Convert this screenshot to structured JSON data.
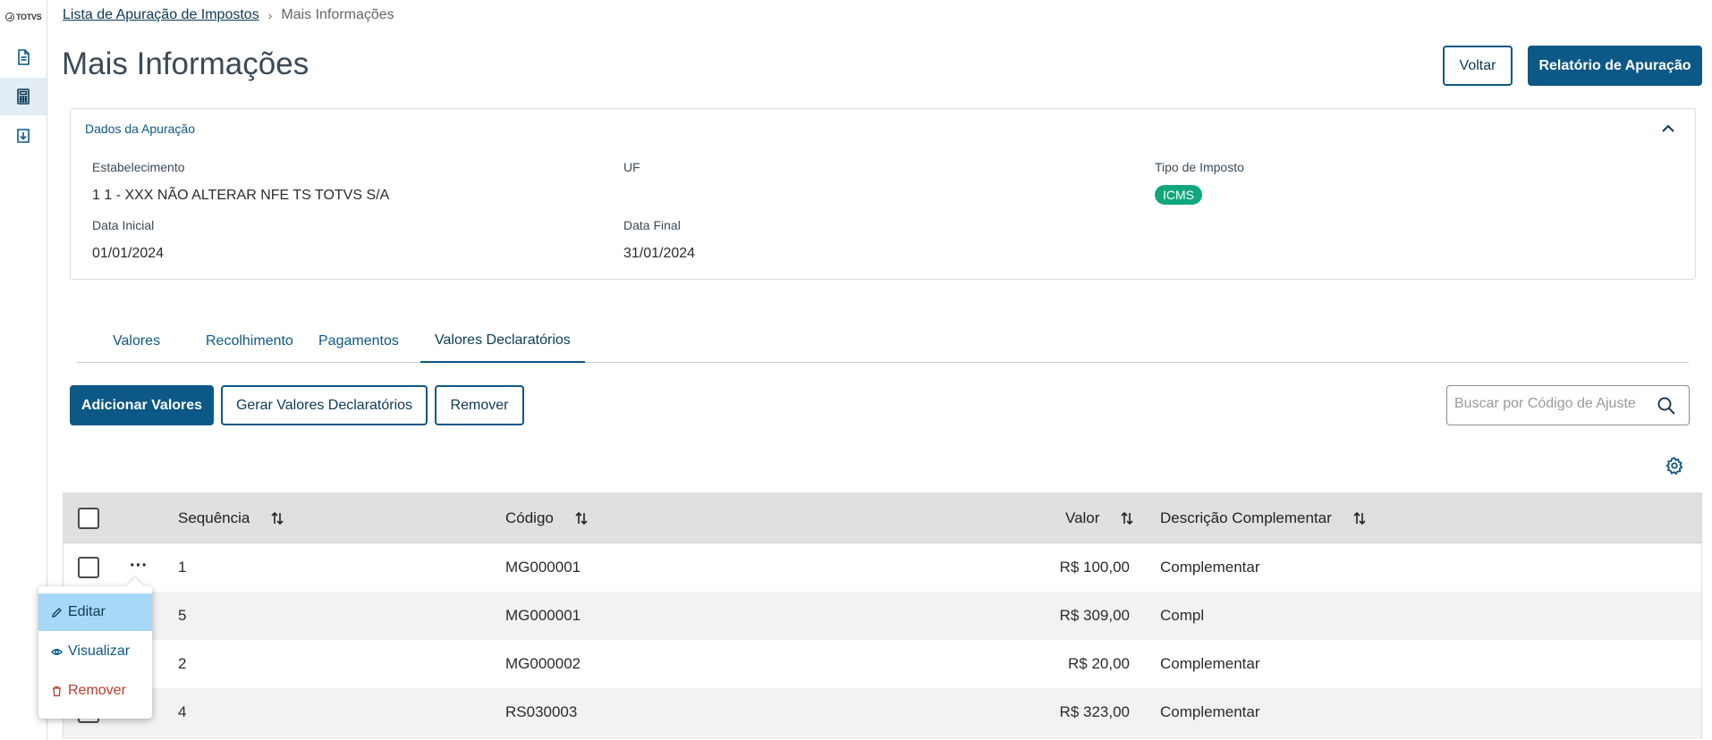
{
  "sidebar": {
    "logo_text": "TOTVS",
    "items": [
      {
        "icon": "document-icon",
        "active": false
      },
      {
        "icon": "calculator-icon",
        "active": true
      },
      {
        "icon": "download-document-icon",
        "active": false
      }
    ]
  },
  "breadcrumb": {
    "parent": "Lista de Apuração de Impostos",
    "current": "Mais Informações"
  },
  "page": {
    "title": "Mais Informações"
  },
  "header_actions": {
    "back_label": "Voltar",
    "report_label": "Relatório de Apuração"
  },
  "card": {
    "title": "Dados da Apuração",
    "fields": {
      "estabelecimento_label": "Estabelecimento",
      "estabelecimento_value": "1 1 - XXX NÃO ALTERAR NFE TS TOTVS S/A",
      "uf_label": "UF",
      "uf_value": "",
      "tipo_label": "Tipo de Imposto",
      "tipo_value": "ICMS",
      "data_inicial_label": "Data Inicial",
      "data_inicial_value": "01/01/2024",
      "data_final_label": "Data Final",
      "data_final_value": "31/01/2024"
    }
  },
  "tabs": [
    {
      "label": "Valores",
      "active": false
    },
    {
      "label": "Recolhimento",
      "active": false
    },
    {
      "label": "Pagamentos",
      "active": false
    },
    {
      "label": "Valores Declaratórios",
      "active": true
    }
  ],
  "toolbar": {
    "add_label": "Adicionar Valores",
    "generate_label": "Gerar Valores Declaratórios",
    "remove_label": "Remover",
    "search_placeholder": "Buscar por Código de Ajuste"
  },
  "table": {
    "columns": [
      "Sequência",
      "Código",
      "Valor",
      "Descrição Complementar"
    ],
    "rows": [
      {
        "sequencia": "1",
        "codigo": "MG000001",
        "valor": "R$ 100,00",
        "descricao": "Complementar"
      },
      {
        "sequencia": "5",
        "codigo": "MG000001",
        "valor": "R$ 309,00",
        "descricao": "Compl"
      },
      {
        "sequencia": "2",
        "codigo": "MG000002",
        "valor": "R$ 20,00",
        "descricao": "Complementar"
      },
      {
        "sequencia": "4",
        "codigo": "RS030003",
        "valor": "R$ 323,00",
        "descricao": "Complementar"
      }
    ]
  },
  "row_menu": {
    "items": [
      {
        "label": "Editar",
        "icon": "pencil-icon"
      },
      {
        "label": "Visualizar",
        "icon": "eye-icon"
      },
      {
        "label": "Remover",
        "icon": "trash-icon"
      }
    ]
  },
  "colors": {
    "primary": "#0c5886",
    "tag_green": "#11a77c",
    "menu_highlight": "#a8d8f7",
    "danger": "#c0392b"
  }
}
